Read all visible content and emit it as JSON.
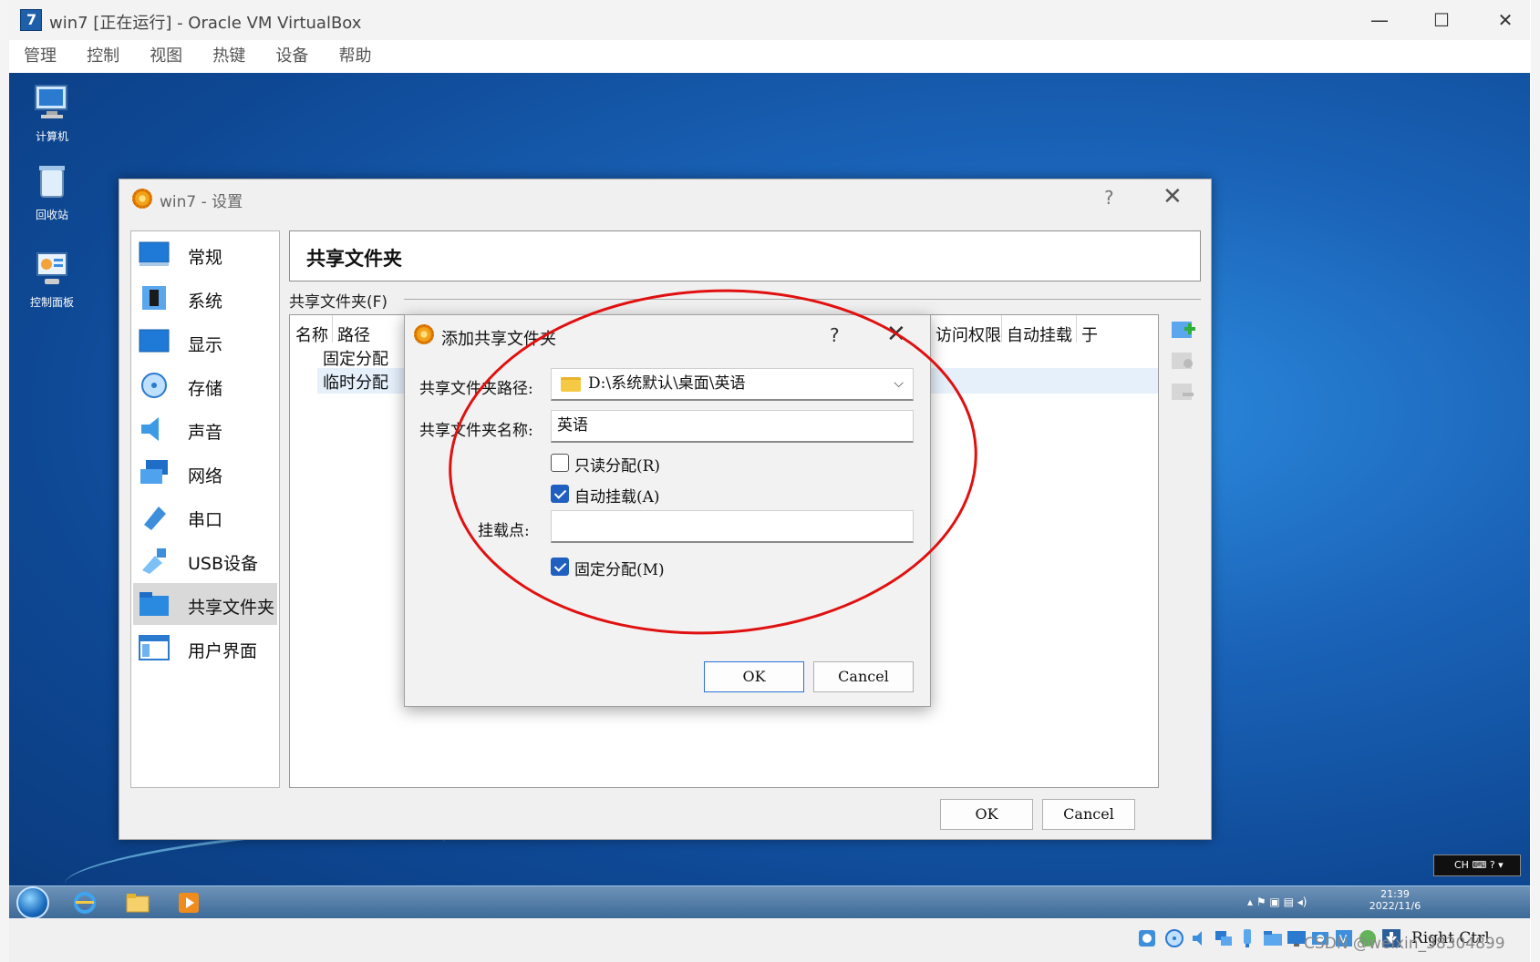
{
  "host": {
    "title": "win7 [正在运行] - Oracle VM VirtualBox",
    "minimize": "—",
    "maximize": "☐",
    "close": "✕",
    "menu": [
      "管理",
      "控制",
      "视图",
      "热键",
      "设备",
      "帮助"
    ]
  },
  "desktop": {
    "icons": [
      {
        "label": "计算机",
        "icon": "computer-icon"
      },
      {
        "label": "回收站",
        "icon": "recycle-bin-icon"
      },
      {
        "label": "控制面板",
        "icon": "control-panel-icon"
      }
    ]
  },
  "taskbar": {
    "time": "21:39",
    "date": "2022/11/6",
    "lang": "CH"
  },
  "status_bar": {
    "host_key": "Right Ctrl",
    "watermark": "CSDN @weixin_38304899"
  },
  "settings": {
    "title": "win7 - 设置",
    "help": "?",
    "close": "✕",
    "sidebar": [
      {
        "label": "常规",
        "icon": "general-icon",
        "color": "#1e7ad6"
      },
      {
        "label": "系统",
        "icon": "system-chip-icon",
        "color": "#2a5f9c"
      },
      {
        "label": "显示",
        "icon": "display-icon",
        "color": "#1e7ad6"
      },
      {
        "label": "存储",
        "icon": "storage-disc-icon",
        "color": "#2a8ae0"
      },
      {
        "label": "声音",
        "icon": "speaker-icon",
        "color": "#3d9be6"
      },
      {
        "label": "网络",
        "icon": "network-icon",
        "color": "#1e6ec8"
      },
      {
        "label": "串口",
        "icon": "serial-port-icon",
        "color": "#3d8fdc"
      },
      {
        "label": "USB设备",
        "icon": "usb-icon",
        "color": "#3d8fdc"
      },
      {
        "label": "共享文件夹",
        "icon": "shared-folder-icon",
        "color": "#2a8ae0"
      },
      {
        "label": "用户界面",
        "icon": "user-interface-icon",
        "color": "#2a7ad0"
      }
    ],
    "selected_index": 8,
    "page_title": "共享文件夹",
    "section_label": "共享文件夹(F)",
    "table": {
      "headers": [
        "名称",
        "路径",
        "访问权限",
        "自动挂载",
        "于"
      ],
      "rows": [
        "固定分配",
        "临时分配"
      ]
    },
    "ok": "OK",
    "cancel": "Cancel"
  },
  "add_dialog": {
    "title": "添加共享文件夹",
    "help": "?",
    "close": "✕",
    "path_label": "共享文件夹路径:",
    "path_value": "D:\\系统默认\\桌面\\英语",
    "name_label": "共享文件夹名称:",
    "name_value": "英语",
    "readonly_label": "只读分配(R)",
    "readonly_checked": false,
    "automount_label": "自动挂载(A)",
    "automount_checked": true,
    "mountpoint_label": "挂载点:",
    "mountpoint_value": "",
    "permanent_label": "固定分配(M)",
    "permanent_checked": true,
    "ok": "OK",
    "cancel": "Cancel"
  }
}
